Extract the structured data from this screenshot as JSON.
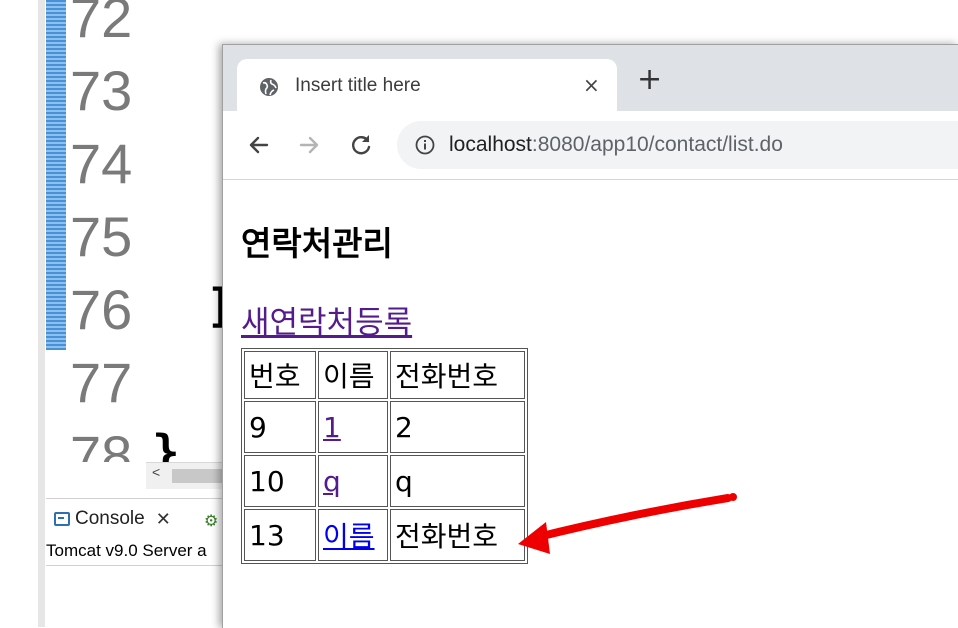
{
  "ide": {
    "line_numbers": [
      "72",
      "73",
      "74",
      "75",
      "76",
      "77",
      "78"
    ],
    "console_tab_label": "Console",
    "console_status": "Tomcat v9.0 Server a"
  },
  "browser": {
    "tab_title": "Insert title here",
    "new_tab_label": "+",
    "close_tab_label": "×",
    "url_host": "localhost",
    "url_path": ":8080/app10/contact/list.do"
  },
  "page": {
    "heading": "연락처관리",
    "new_contact_link": "새연락처등록",
    "table": {
      "headers": [
        "번호",
        "이름",
        "전화번호"
      ],
      "rows": [
        [
          "9",
          "1",
          "2"
        ],
        [
          "10",
          "q",
          "q"
        ],
        [
          "13",
          "이름",
          "전화번호"
        ]
      ]
    }
  },
  "annotation": {
    "arrow_color": "#ee0000"
  }
}
